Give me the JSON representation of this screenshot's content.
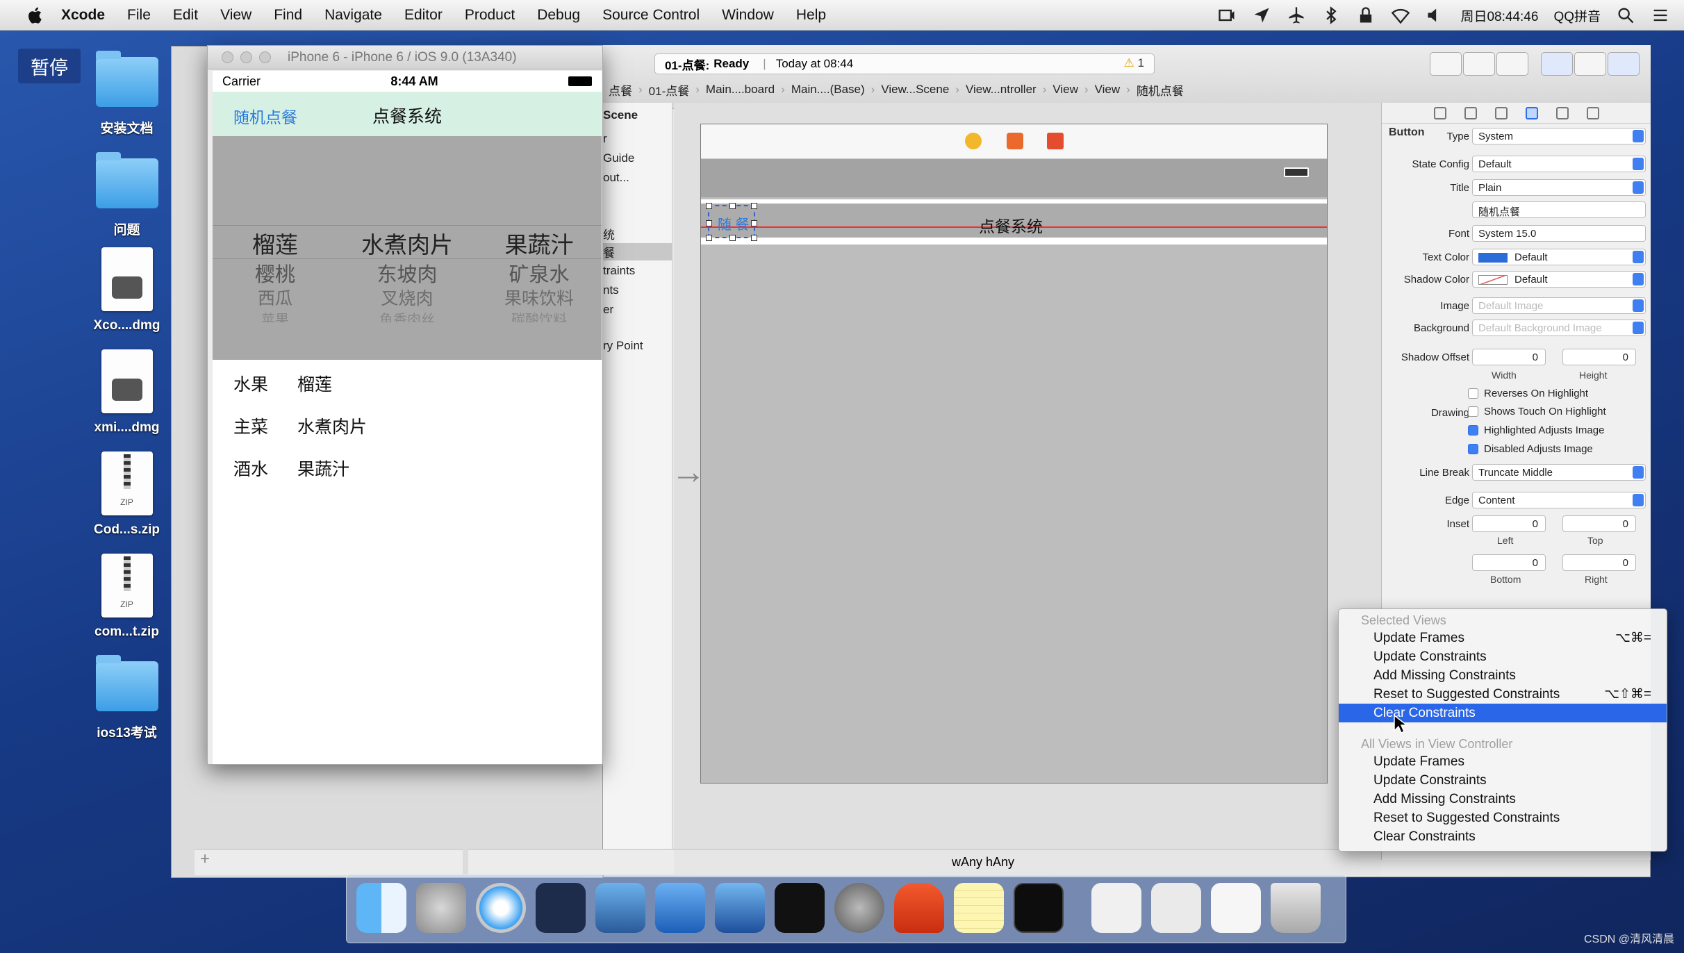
{
  "menubar": {
    "app": "Xcode",
    "items": [
      "File",
      "Edit",
      "View",
      "Find",
      "Navigate",
      "Editor",
      "Product",
      "Debug",
      "Source Control",
      "Window",
      "Help"
    ],
    "clock": "周日08:44:46",
    "ime": "QQ拼音"
  },
  "desktop": {
    "pause": "暂停",
    "icons": [
      "安装文档",
      "问题",
      "Xco....dmg",
      "xmi....dmg",
      "Cod...s.zip",
      "com...t.zip",
      "ios13考试"
    ],
    "zip_label": "ZIP"
  },
  "simulator": {
    "title": "iPhone 6 - iPhone 6 / iOS 9.0 (13A340)",
    "carrier": "Carrier",
    "time": "8:44 AM",
    "nav_button": "随机点餐",
    "nav_title": "点餐系统",
    "picker": [
      [
        "榴莲",
        "樱桃",
        "西瓜",
        "苹果"
      ],
      [
        "水煮肉片",
        "东坡肉",
        "叉烧肉",
        "鱼香肉丝"
      ],
      [
        "果蔬汁",
        "矿泉水",
        "果味饮料",
        "碳酸饮料"
      ]
    ],
    "results": [
      {
        "k": "水果",
        "v": "榴莲"
      },
      {
        "k": "主菜",
        "v": "水煮肉片"
      },
      {
        "k": "酒水",
        "v": "果蔬汁"
      }
    ]
  },
  "xcode": {
    "activity_scheme": "01-点餐:",
    "activity_status": "Ready",
    "activity_time": "Today at 08:44",
    "warnings": "1",
    "jumpbar": [
      "点餐",
      "01-点餐",
      "Main....board",
      "Main....(Base)",
      "View...Scene",
      "View...ntroller",
      "View",
      "View",
      "随机点餐"
    ],
    "outline": [
      "Scene",
      "r",
      "Guide",
      "out...",
      "统",
      "餐",
      "traints",
      "nts",
      "er",
      "ry Point"
    ],
    "canvas_title": "点餐系统",
    "canvas_button": "随 餐",
    "size_class": "wAny hAny"
  },
  "inspector": {
    "section": "Button",
    "type_label": "Type",
    "type": "System",
    "state_label": "State Config",
    "state": "Default",
    "title_label": "Title",
    "title_style": "Plain",
    "title_text": "随机点餐",
    "font_label": "Font",
    "font": "System 15.0",
    "textcolor_label": "Text Color",
    "textcolor": "Default",
    "shadowcolor_label": "Shadow Color",
    "shadowcolor": "Default",
    "image_label": "Image",
    "image": "Default Image",
    "bg_label": "Background",
    "bg": "Default Background Image",
    "shadow_offset_label": "Shadow Offset",
    "width_label": "Width",
    "height_label": "Height",
    "zero": "0",
    "drawing_label": "Drawing",
    "chk": [
      "Reverses On Highlight",
      "Shows Touch On Highlight",
      "Highlighted Adjusts Image",
      "Disabled Adjusts Image"
    ],
    "linebreak_label": "Line Break",
    "linebreak": "Truncate Middle",
    "edge_label": "Edge",
    "edge": "Content",
    "inset_label": "Inset",
    "left": "Left",
    "top": "Top",
    "bottom": "Bottom",
    "right": "Right"
  },
  "menu": {
    "sec1": "Selected Views",
    "sec2": "All Views in View Controller",
    "items1": [
      {
        "label": "Update Frames",
        "kb": "⌥⌘="
      },
      {
        "label": "Update Constraints",
        "kb": ""
      },
      {
        "label": "Add Missing Constraints",
        "kb": ""
      },
      {
        "label": "Reset to Suggested Constraints",
        "kb": "⌥⇧⌘="
      },
      {
        "label": "Clear Constraints",
        "kb": ""
      }
    ],
    "items2": [
      "Update Frames",
      "Update Constraints",
      "Add Missing Constraints",
      "Reset to Suggested Constraints",
      "Clear Constraints"
    ]
  },
  "colors": {
    "accent": "#2a66e8",
    "nav_bg": "#d6f1e4",
    "desktop": "#1f4a9b"
  },
  "watermark": "CSDN @清风清晨"
}
